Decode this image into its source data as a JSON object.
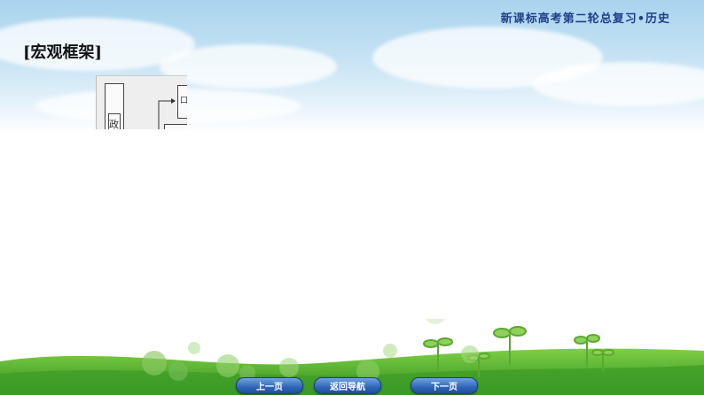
{
  "header": {
    "title": "新课标高考第二轮总复习•历史"
  },
  "section": {
    "title": "[宏观框架]"
  },
  "diagram": {
    "glyph_1": "政",
    "glyph_2": "口"
  },
  "navigation": {
    "prev_label": "上一页",
    "home_label": "返回导航",
    "next_label": "下一页"
  },
  "colors": {
    "header": "#1f3f8a",
    "nav_button": "#2f66b8",
    "grass": "#4caf2a"
  }
}
